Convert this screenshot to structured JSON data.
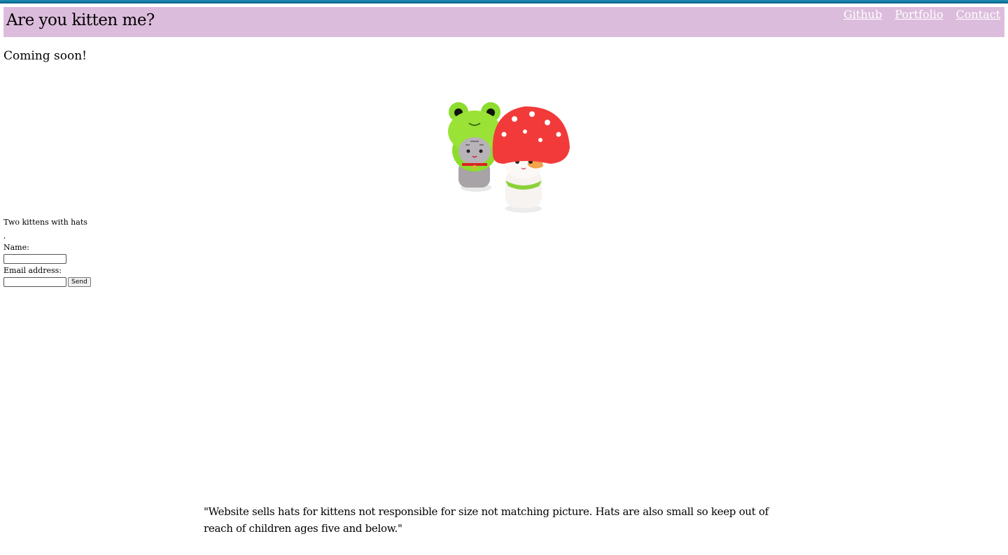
{
  "header": {
    "title": "Are you kitten me?",
    "nav": [
      {
        "label": "Github"
      },
      {
        "label": "Portfolio"
      },
      {
        "label": "Contact"
      }
    ],
    "background": "#dcbcdc"
  },
  "main": {
    "heading": "Coming soon!",
    "image": {
      "caption": "Two kittens with hats",
      "after_caption": ","
    },
    "form": {
      "name_label": "Name:",
      "name_value": "",
      "email_label": "Email address:",
      "email_value": "",
      "send_label": "Send"
    }
  },
  "footer": {
    "disclaimer": "\"Website sells hats for kittens not responsible for size not matching picture. Hats are also small so keep out of reach of children ages five and below.\""
  },
  "colors": {
    "top_strip": "#0d5f86",
    "nav_link": "#ffffff"
  }
}
